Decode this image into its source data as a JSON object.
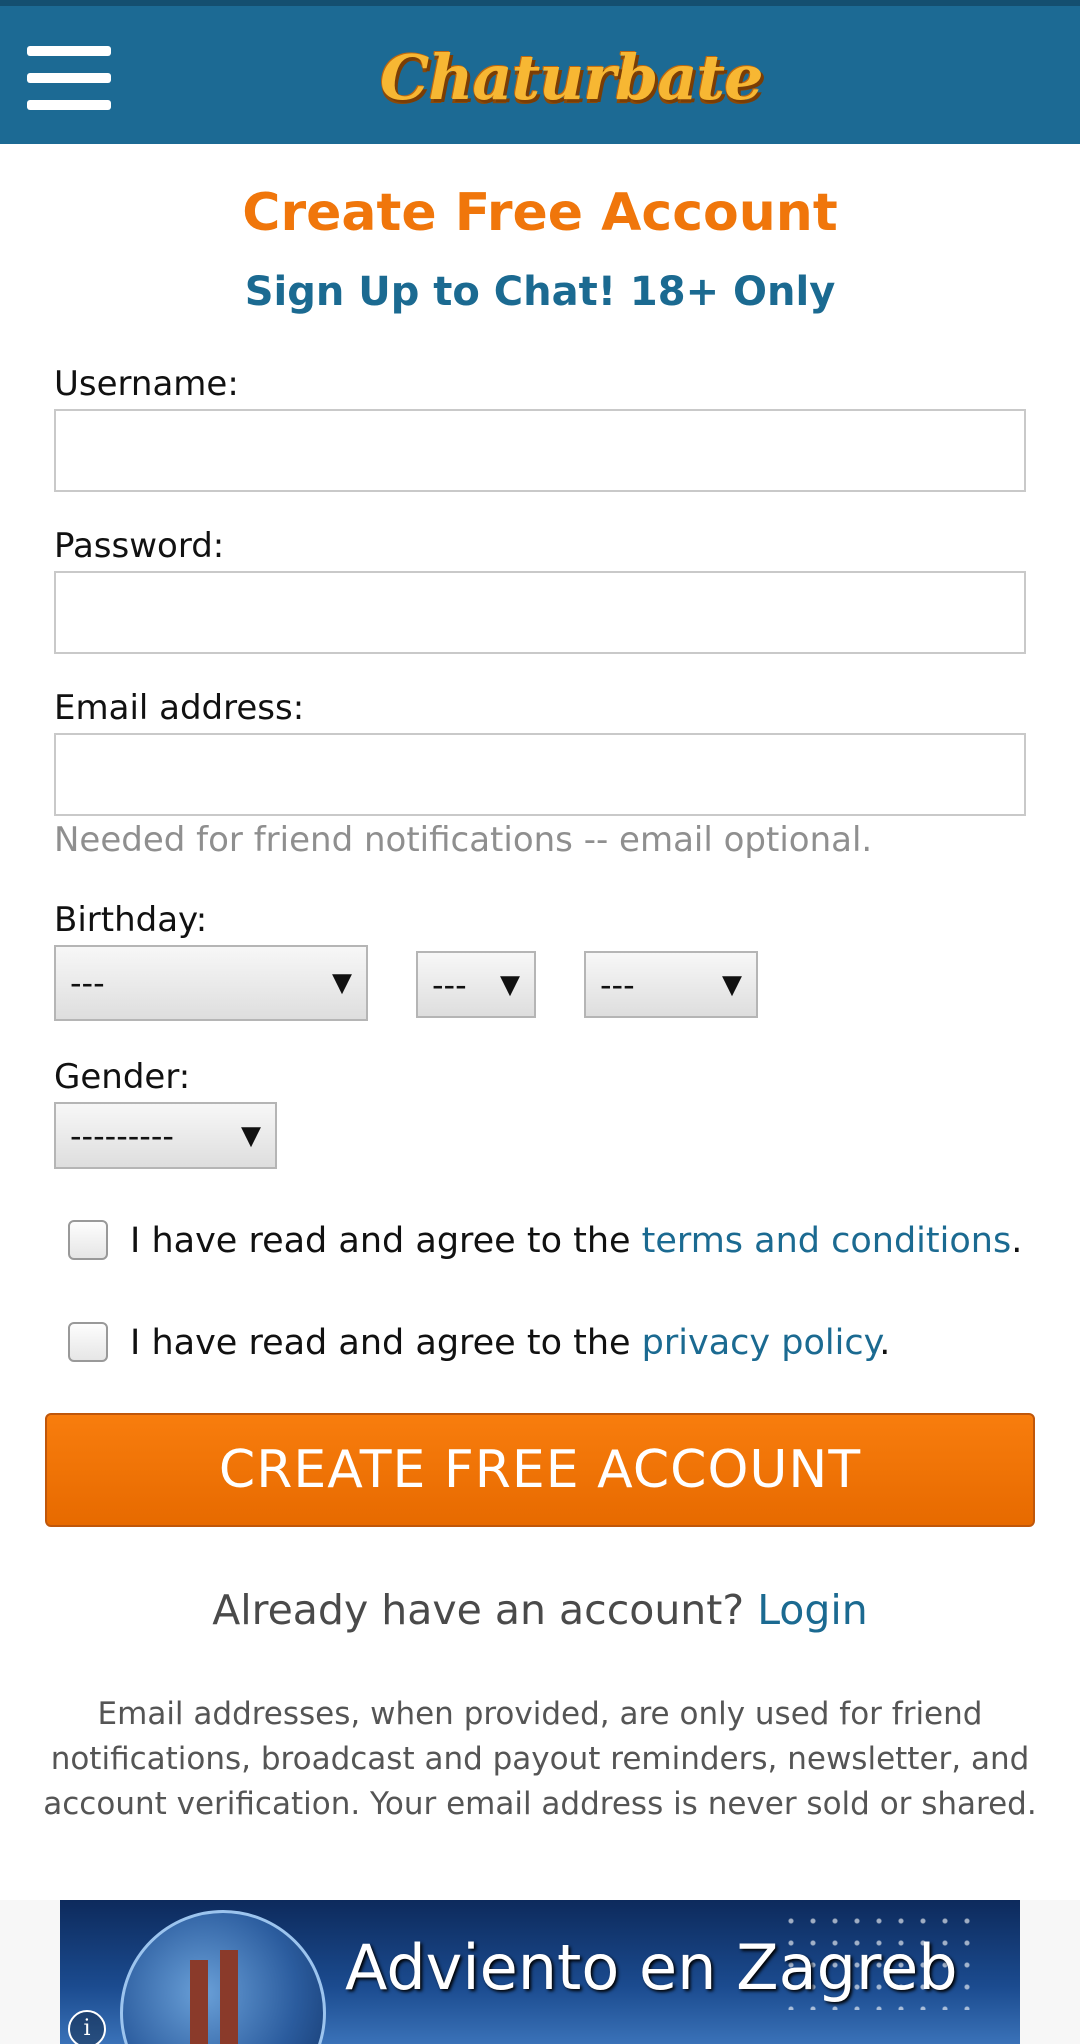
{
  "header": {
    "logo_text": "Chaturbate",
    "menu_icon": "hamburger-menu-icon"
  },
  "form": {
    "title": "Create Free Account",
    "subtitle": "Sign Up to Chat! 18+ Only",
    "username_label": "Username:",
    "username_value": "",
    "password_label": "Password:",
    "password_value": "",
    "email_label": "Email address:",
    "email_value": "",
    "email_hint": "Needed for friend notifications -- email optional.",
    "birthday_label": "Birthday:",
    "birthday_month": "---",
    "birthday_day": "---",
    "birthday_year": "---",
    "gender_label": "Gender:",
    "gender_value": "---------",
    "dropdown_arrow": "▼",
    "terms_prefix": "I have read and agree to the ",
    "terms_link": "terms and conditions",
    "terms_suffix": ".",
    "privacy_prefix": "I have read and agree to the ",
    "privacy_link": "privacy policy",
    "privacy_suffix": ".",
    "submit_label": "CREATE FREE ACCOUNT",
    "already_text": "Already have an account?",
    "login_link": "Login",
    "disclaimer": "Email addresses, when provided, are only used for friend notifications, broadcast and payout reminders, newsletter, and account verification. Your email address is never sold or shared."
  },
  "ad": {
    "text": "Adviento en Zagreb",
    "info_glyph": "i"
  },
  "colors": {
    "header_bg": "#1c6a94",
    "title": "#f0760b",
    "subtitle": "#1b6a91",
    "button": "#f07a0b",
    "link": "#1b6a91"
  }
}
